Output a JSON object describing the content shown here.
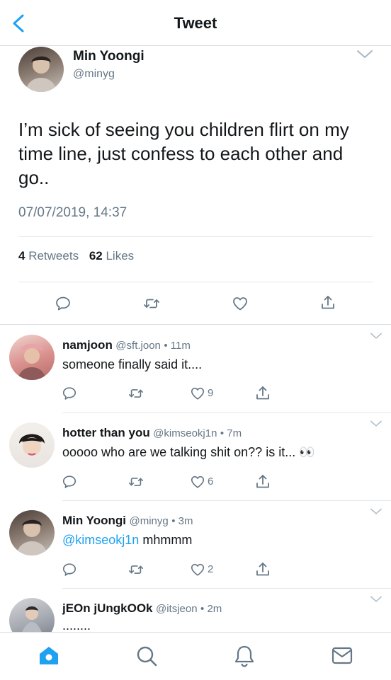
{
  "header": {
    "title": "Tweet"
  },
  "main_tweet": {
    "name": "Min Yoongi",
    "handle": "@minyg",
    "text": "I’m sick of seeing you children flirt on my time line, just confess to each other and go..",
    "text_lines": [
      "I’m sick of seeing you children flirt on my",
      "time line, just confess to each other and",
      "go.."
    ],
    "timestamp": "07/07/2019, 14:37",
    "retweets_count": "4",
    "retweets_label": "Retweets",
    "likes_count": "62",
    "likes_label": "Likes"
  },
  "replies": [
    {
      "name": "namjoon",
      "handle": "@sft.joon",
      "time": "• 11m",
      "text": "someone finally said it....",
      "likes": "9"
    },
    {
      "name": "hotter than you",
      "handle": "@kimseokj1n",
      "time": "• 7m",
      "text": "ooooo who are we talking shit on?? is it...",
      "emoji": "👀",
      "likes": "6"
    },
    {
      "name": "Min Yoongi",
      "handle": "@minyg",
      "time": "• 3m",
      "mention": "@kimseokj1n",
      "text": "mhmmm",
      "likes": "2"
    },
    {
      "name": "jEOn jUngkOOk",
      "handle": "@itsjeon",
      "time": "• 2m",
      "text": "........"
    }
  ],
  "icons": {
    "back": "chevron-left-icon",
    "reply": "reply-icon",
    "retweet": "retweet-icon",
    "like": "heart-icon",
    "share": "share-icon",
    "home": "home-icon",
    "search": "search-icon",
    "notifications": "bell-icon",
    "messages": "mail-icon"
  },
  "colors": {
    "accent": "#1da1f2",
    "muted": "#657786",
    "text": "#14171a",
    "divider": "#e1e8ed"
  }
}
